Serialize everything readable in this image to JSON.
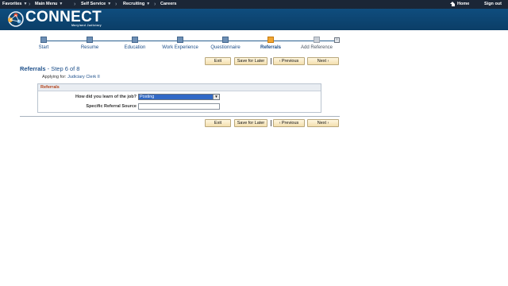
{
  "topnav": {
    "favorites": "Favorites",
    "main_menu": "Main Menu",
    "self_service": "Self Service",
    "recruiting": "Recruiting",
    "careers": "Careers",
    "home": "Home",
    "sign_out": "Sign out",
    "caret_glyph": "▼",
    "separator_glyph": "›"
  },
  "banner": {
    "brand": "CONNECT",
    "sub": "Maryland Judiciary",
    "colors": {
      "bar": "#1b2636",
      "banner": "#0f4d7e",
      "accent": "#f0a532"
    }
  },
  "steps": [
    {
      "label": "Start",
      "state": "done"
    },
    {
      "label": "Resume",
      "state": "done"
    },
    {
      "label": "Education",
      "state": "done"
    },
    {
      "label": "Work Experience",
      "state": "done"
    },
    {
      "label": "Questionnaire",
      "state": "done"
    },
    {
      "label": "Referrals",
      "state": "active"
    },
    {
      "label": "Add Reference",
      "state": "todo"
    }
  ],
  "buttons": {
    "exit": "Exit",
    "save_for_later": "Save for Later",
    "previous": "Previous",
    "next": "Next",
    "prev_arrow": "‹",
    "next_arrow": "›"
  },
  "page": {
    "title": "Referrals",
    "step_count": " - Step 6 of 8",
    "applying_for_label": "Applying for:",
    "applying_for_value": "Judiciary Clerk II"
  },
  "referrals": {
    "group_title": "Referrals",
    "how_learned_label": "How did you learn of the job?",
    "how_learned_value": "Posting",
    "dropdown_glyph": "▼",
    "specific_source_label": "Specific Referral Source",
    "specific_source_value": ""
  }
}
